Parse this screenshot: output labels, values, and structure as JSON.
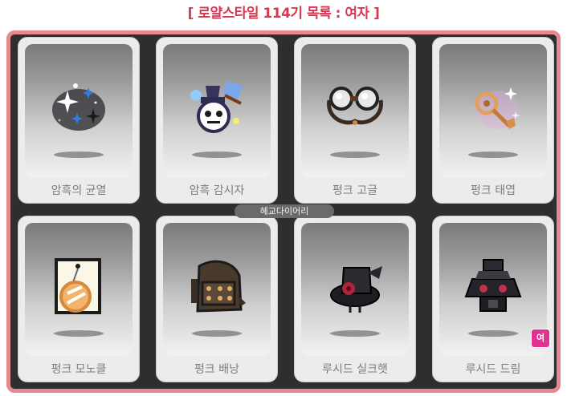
{
  "header": {
    "title": "[ 로얄스타일 114기 목록 : 여자 ]"
  },
  "watermark": "혜교다이어리",
  "colors": {
    "title": "#d9364f",
    "panel_border": "#e78a8f",
    "panel_bg": "#2e2e2e",
    "badge": "#e0338f"
  },
  "items": [
    {
      "name": "암흑의 균열",
      "icon": "dark-crack-effect-icon"
    },
    {
      "name": "암흑 감시자",
      "icon": "dark-watcher-pet-icon"
    },
    {
      "name": "펑크 고글",
      "icon": "punk-goggles-icon"
    },
    {
      "name": "펑크 태엽",
      "icon": "punk-windup-key-icon"
    },
    {
      "name": "펑크 모노클",
      "icon": "punk-monocle-icon"
    },
    {
      "name": "펑크 배낭",
      "icon": "punk-backpack-icon"
    },
    {
      "name": "루시드 실크햇",
      "icon": "lucid-silk-hat-icon"
    },
    {
      "name": "루시드 드림",
      "icon": "lucid-dream-outfit-icon",
      "badge": "여"
    }
  ]
}
